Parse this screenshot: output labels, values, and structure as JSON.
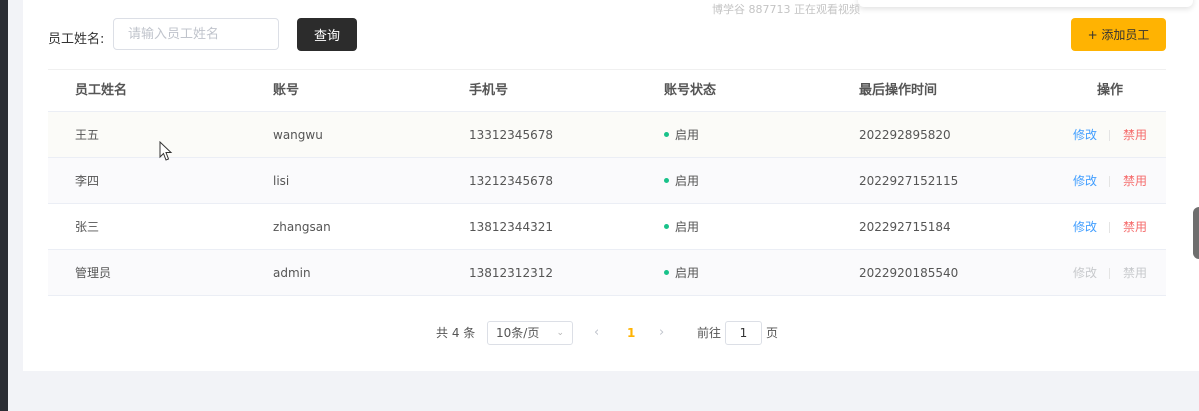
{
  "overlay": {
    "watermark": "博学谷 887713 正在观看视频"
  },
  "search": {
    "label": "员工姓名:",
    "placeholder": "请输入员工姓名",
    "value": "",
    "query_label": "查询",
    "add_label": "+ 添加员工"
  },
  "table": {
    "columns": [
      "员工姓名",
      "账号",
      "手机号",
      "账号状态",
      "最后操作时间",
      "操作"
    ],
    "rows": [
      {
        "name": "王五",
        "account": "wangwu",
        "phone": "13312345678",
        "status": "启用",
        "time": "202292895820",
        "edit": "修改",
        "disable": "禁用"
      },
      {
        "name": "李四",
        "account": "lisi",
        "phone": "13212345678",
        "status": "启用",
        "time": "2022927152115",
        "edit": "修改",
        "disable": "禁用"
      },
      {
        "name": "张三",
        "account": "zhangsan",
        "phone": "13812344321",
        "status": "启用",
        "time": "202292715184",
        "edit": "修改",
        "disable": "禁用"
      },
      {
        "name": "管理员",
        "account": "admin",
        "phone": "13812312312",
        "status": "启用",
        "time": "2022920185540",
        "edit": "修改",
        "disable": "禁用"
      }
    ]
  },
  "pagination": {
    "total": "共 4 条",
    "page_size": "10条/页",
    "current_page": "1",
    "goto_prefix": "前往",
    "goto_value": "1",
    "goto_suffix": "页"
  },
  "colors": {
    "accent": "#ffb302",
    "link": "#419eff",
    "danger": "#f56c6c",
    "status_active": "#19c28a",
    "query_button": "#2c2c2c"
  }
}
